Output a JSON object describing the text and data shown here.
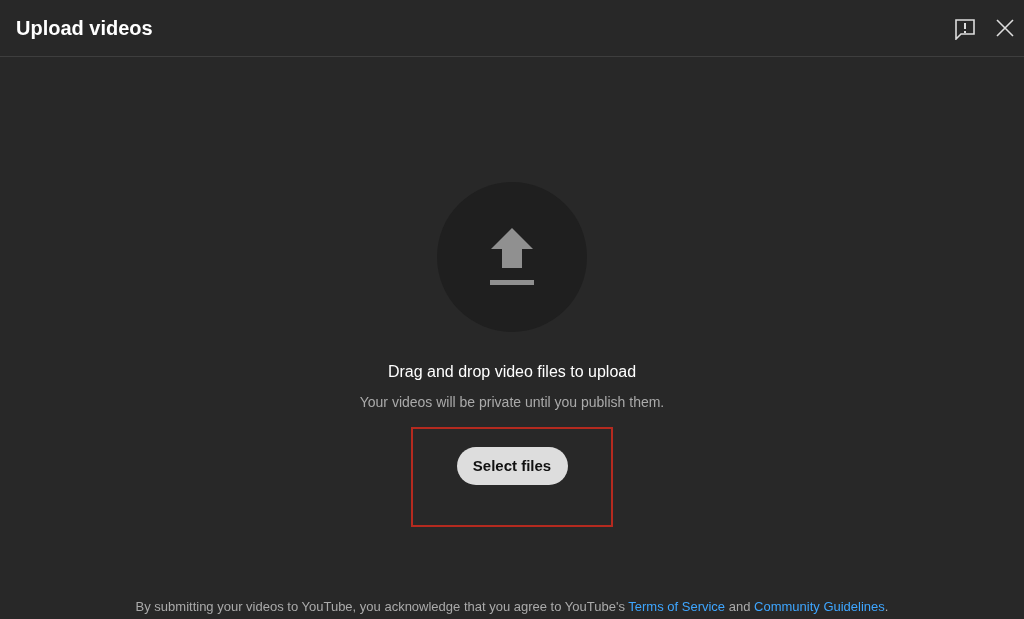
{
  "dialog": {
    "title": "Upload videos"
  },
  "drop_zone": {
    "heading": "Drag and drop video files to upload",
    "subtitle": "Your videos will be private until you publish them.",
    "button": "Select files",
    "highlighted": true
  },
  "footer": {
    "parts": [
      {
        "kind": "text",
        "text": "By submitting your videos to YouTube, you acknowledge that you agree to YouTube's "
      },
      {
        "kind": "link",
        "text": "Terms of Service"
      },
      {
        "kind": "text",
        "text": " and "
      },
      {
        "kind": "link",
        "text": "Community Guidelines"
      },
      {
        "kind": "text",
        "text": "."
      }
    ]
  }
}
